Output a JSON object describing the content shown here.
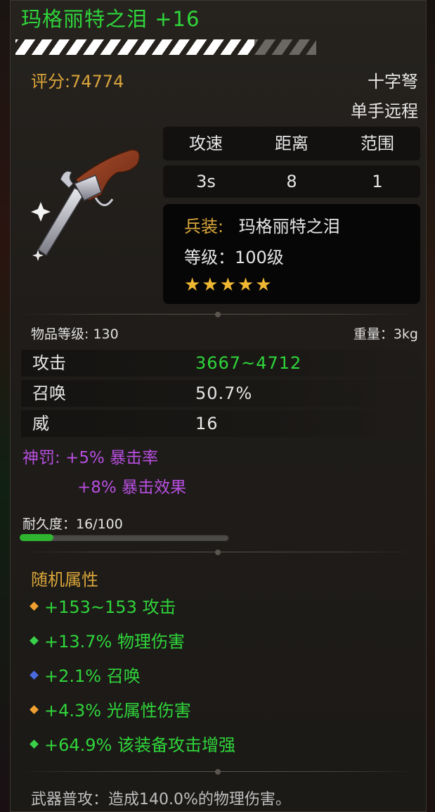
{
  "item": {
    "title": "玛格丽特之泪 +16",
    "score": "评分:74774",
    "weapon_type": "十字弩",
    "hand_type": "单手远程",
    "image_icon": "flintlock-pistol-icon"
  },
  "stats_table": {
    "headers": [
      "攻速",
      "距离",
      "范围"
    ],
    "values": [
      "3s",
      "8",
      "1"
    ]
  },
  "gear_info": {
    "gear_label": "兵装:",
    "gear_name": "玛格丽特之泪",
    "level_text": "等级：100级",
    "stars": "★★★★★",
    "star_count": 5
  },
  "meta": {
    "item_level": "物品等级: 130",
    "weight": "重量：3kg"
  },
  "attributes": [
    {
      "name": "攻击",
      "value": "3667~4712",
      "color": "#2fd53a"
    },
    {
      "name": "召唤",
      "value": "50.7%",
      "color": "#e6e6e6"
    },
    {
      "name": "威",
      "value": "16",
      "color": "#e6e6e6"
    }
  ],
  "divine": {
    "label": "神罚:",
    "line1": "+5% 暴击率",
    "line2": "+8% 暴击效果"
  },
  "durability": {
    "label": "耐久度：16/100",
    "fraction": 0.16
  },
  "random_attrs": {
    "title": "随机属性",
    "items": [
      {
        "text": "+153~153 攻击",
        "gem": "gold-gem-icon",
        "gem_color": "#f0a030"
      },
      {
        "text": "+13.7% 物理伤害",
        "gem": "green-gem-icon",
        "gem_color": "#3ad24a"
      },
      {
        "text": "+2.1% 召唤",
        "gem": "blue-gem-icon",
        "gem_color": "#4a6ae0"
      },
      {
        "text": "+4.3% 光属性伤害",
        "gem": "gold-gem-icon",
        "gem_color": "#f0a030"
      },
      {
        "text": "+64.9% 该装备攻击增强",
        "gem": "green-gem-icon",
        "gem_color": "#3ad24a"
      }
    ]
  },
  "footer": {
    "text": "武器普攻：造成140.0%的物理伤害。"
  },
  "colors": {
    "title_green": "#2fd53a",
    "gold": "#d9a53a",
    "purple": "#b84fe0",
    "star": "#f0b832"
  }
}
